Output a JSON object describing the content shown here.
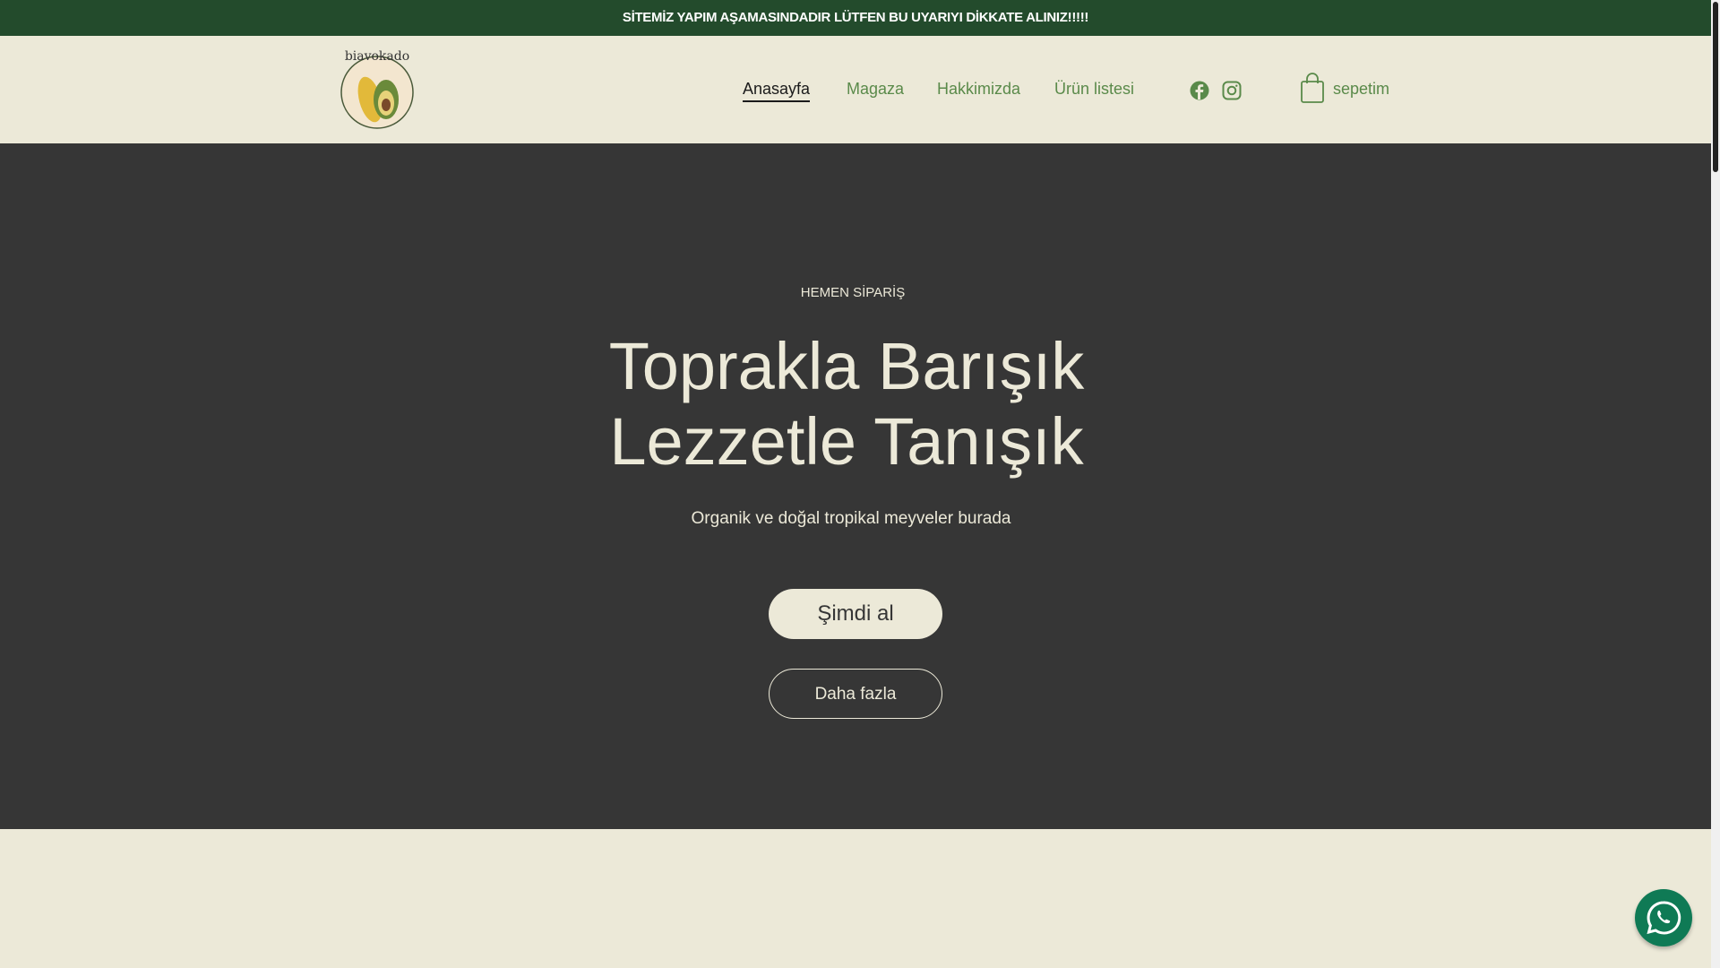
{
  "banner": {
    "text": "SİTEMİZ YAPIM AŞAMASINDADIR LÜTFEN BU UYARIYI DİKKATE ALINIZ!!!!!"
  },
  "header": {
    "logo_text": "biavokado",
    "nav": [
      {
        "label": "Anasayfa"
      },
      {
        "label": "Magaza"
      },
      {
        "label": "Hakkimizda"
      },
      {
        "label": "Ürün listesi"
      }
    ],
    "cart_label": "sepetim"
  },
  "hero": {
    "eyebrow": "HEMEN SİPARİŞ",
    "title_line1": "Toprakla Barışık",
    "title_line2": "Lezzetle Tanışık",
    "subtitle": "Organik ve doğal tropikal meyveler burada",
    "primary_button": "Şimdi al",
    "secondary_button": "Daha fazla"
  },
  "colors": {
    "banner": "#234b2c",
    "header_bg": "#ece9d8",
    "hero_bg": "#363636",
    "nav_green": "#5a8a4a",
    "whatsapp": "#0f7a55"
  }
}
